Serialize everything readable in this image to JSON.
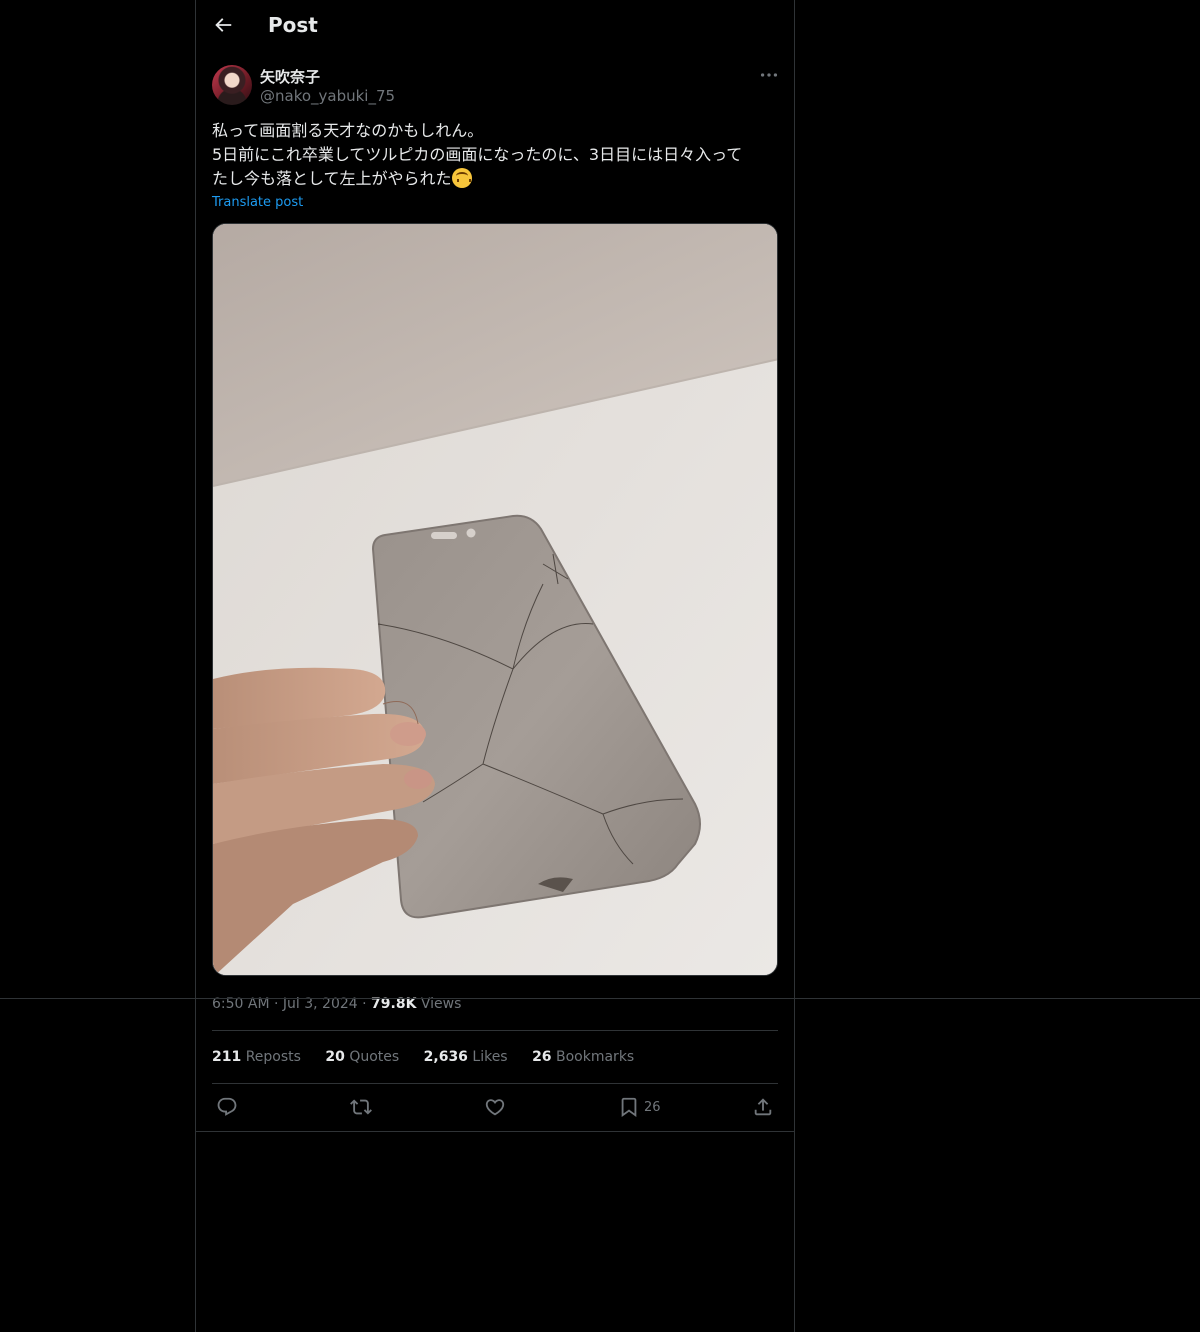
{
  "header": {
    "title": "Post"
  },
  "post": {
    "author_name": "矢吹奈子",
    "handle": "@nako_yabuki_75",
    "text_lines": [
      "私って画面割る天才なのかもしれん。",
      "5日前にこれ卒業してツルピカの画面になったのに、3日目には日々入って",
      "たし今も落として左上がやられた"
    ],
    "translate": "Translate post",
    "time": "6:50 AM",
    "date": "Jul 3, 2024",
    "views_count": "79.8K",
    "views_label": "Views",
    "stats": {
      "reposts_count": "211",
      "reposts_label": "Reposts",
      "quotes_count": "20",
      "quotes_label": "Quotes",
      "likes_count": "2,636",
      "likes_label": "Likes",
      "bookmarks_count": "26",
      "bookmarks_label": "Bookmarks"
    },
    "actions": {
      "bookmark_count": "26"
    }
  },
  "icons": [
    "back-arrow-icon",
    "more-icon",
    "reply-icon",
    "repost-icon",
    "like-icon",
    "bookmark-icon",
    "share-icon",
    "upside-down-face-emoji"
  ],
  "colors": {
    "background": "#000000",
    "text": "#e7e9ea",
    "muted": "#71767b",
    "link": "#1d9bf0",
    "border": "#2f3336"
  }
}
